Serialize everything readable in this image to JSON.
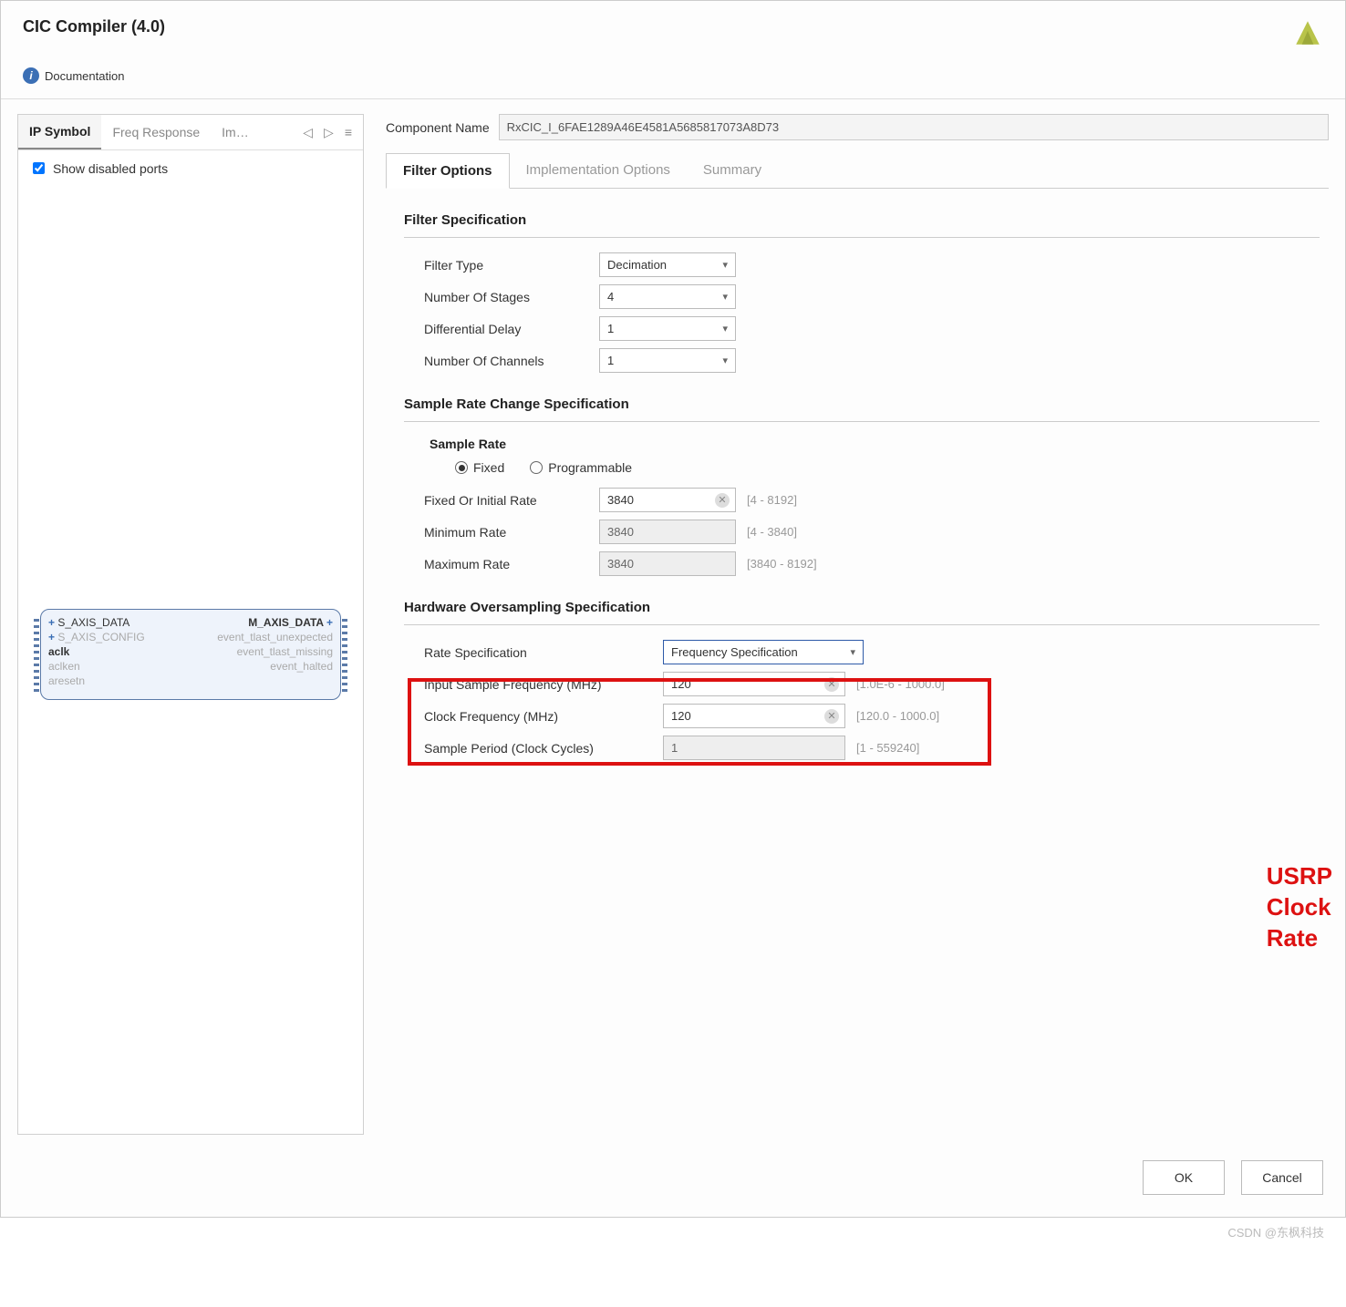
{
  "header": {
    "title": "CIC Compiler (4.0)",
    "documentation": "Documentation"
  },
  "left": {
    "tabs": {
      "ip_symbol": "IP Symbol",
      "freq_response": "Freq Response",
      "overflow": "Im…"
    },
    "show_disabled": "Show disabled ports",
    "ip_block": {
      "in0": "S_AXIS_DATA",
      "in1": "S_AXIS_CONFIG",
      "in2": "aclk",
      "in3": "aclken",
      "in4": "aresetn",
      "out0": "M_AXIS_DATA",
      "out1": "event_tlast_unexpected",
      "out2": "event_tlast_missing",
      "out3": "event_halted"
    }
  },
  "component": {
    "label": "Component Name",
    "value": "RxCIC_I_6FAE1289A46E4581A5685817073A8D73"
  },
  "tabs": {
    "filter": "Filter Options",
    "impl": "Implementation Options",
    "summary": "Summary"
  },
  "filter_spec": {
    "heading": "Filter Specification",
    "filter_type_lbl": "Filter Type",
    "filter_type": "Decimation",
    "stages_lbl": "Number Of Stages",
    "stages": "4",
    "diff_delay_lbl": "Differential Delay",
    "diff_delay": "1",
    "channels_lbl": "Number Of Channels",
    "channels": "1"
  },
  "rate_spec": {
    "heading": "Sample Rate Change Specification",
    "sub": "Sample Rate",
    "radio_fixed": "Fixed",
    "radio_prog": "Programmable",
    "fixed_lbl": "Fixed Or Initial Rate",
    "fixed_val": "3840",
    "fixed_range": "[4 - 8192]",
    "min_lbl": "Minimum Rate",
    "min_val": "3840",
    "min_range": "[4 - 3840]",
    "max_lbl": "Maximum Rate",
    "max_val": "3840",
    "max_range": "[3840 - 8192]"
  },
  "hw_spec": {
    "heading": "Hardware Oversampling Specification",
    "rate_spec_lbl": "Rate Specification",
    "rate_spec_val": "Frequency Specification",
    "in_freq_lbl": "Input Sample Frequency (MHz)",
    "in_freq_val": "120",
    "in_freq_range": "[1.0E-6 - 1000.0]",
    "clk_freq_lbl": "Clock Frequency (MHz)",
    "clk_freq_val": "120",
    "clk_freq_range": "[120.0 - 1000.0]",
    "period_lbl": "Sample Period (Clock Cycles)",
    "period_val": "1",
    "period_range": "[1 - 559240]"
  },
  "annotation": "USRP\nClock\nRate",
  "buttons": {
    "ok": "OK",
    "cancel": "Cancel"
  },
  "watermark": "CSDN @东枫科技"
}
